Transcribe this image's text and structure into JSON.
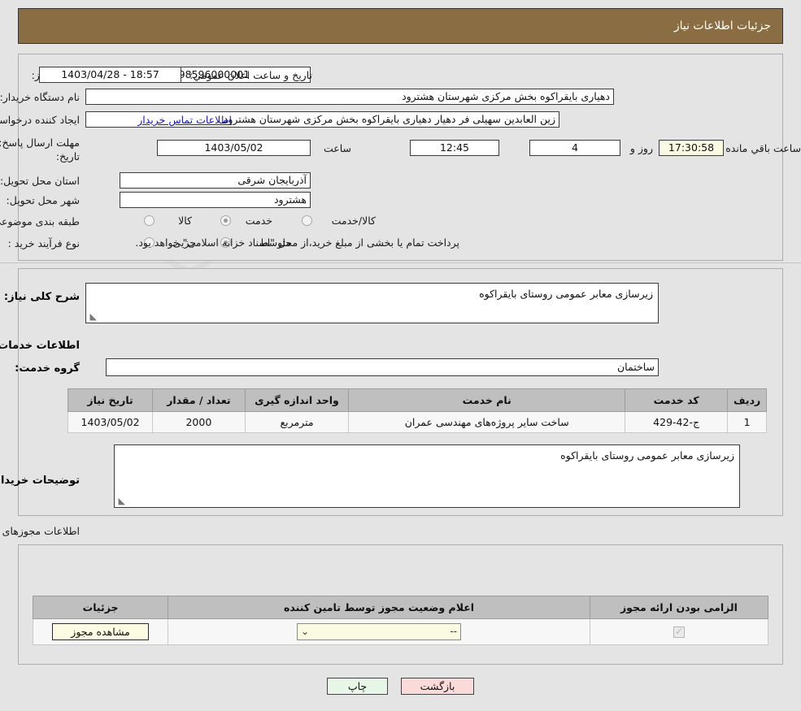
{
  "header": {
    "title": "جزئیات اطلاعات نیاز"
  },
  "watermark": {
    "text": "AnaTender.net"
  },
  "form": {
    "need_number_label": "شماره نیاز:",
    "need_number_value": "1103098596000001",
    "announce_datetime_label": "تاریخ و ساعت اعلان عمومي:",
    "announce_datetime_value": "1403/04/28 - 18:57",
    "buyer_org_label": "نام دستگاه خریدار:",
    "buyer_org_value": "دهیاری بایقراکوه بخش مرکزی شهرستان هشترود",
    "creator_label": "ایجاد کننده درخواست:",
    "creator_value": "زین العابدین سهیلی فر دهیار دهیاری بایقراکوه بخش مرکزی شهرستان هشترود",
    "buyer_contact_link": "اطلاعات تماس خریدار",
    "deadline_label": "مهلت ارسال پاسخ: تا تاریخ:",
    "deadline_date": "1403/05/02",
    "deadline_time_label": "ساعت",
    "deadline_time": "12:45",
    "remaining_days": "4",
    "remaining_days_label": "روز و",
    "remaining_time": "17:30:58",
    "remaining_time_label": "ساعت باقي مانده",
    "province_label": "استان محل تحویل:",
    "province_value": "آذربایجان شرقی",
    "city_label": "شهر محل تحویل:",
    "city_value": "هشترود",
    "category_label": "طبقه بندی موضوعی:",
    "category_options": [
      {
        "label": "کالا",
        "selected": false
      },
      {
        "label": "خدمت",
        "selected": true
      },
      {
        "label": "کالا/خدمت",
        "selected": false
      }
    ],
    "process_label": "نوع فرآیند خرید :",
    "process_options": [
      {
        "label": "جزیی",
        "selected": false
      },
      {
        "label": "متوسط",
        "selected": true
      }
    ],
    "treasury_note": "پرداخت تمام یا بخشی از مبلغ خرید،از محل \"اسناد خزانه اسلامی\" خواهد بود."
  },
  "middle": {
    "general_desc_label": "شرح کلی نیاز:",
    "general_desc_value": "زیرسازی معابر عمومی روستای بایقراکوه",
    "services_info_title": "اطلاعات خدمات مورد نیاز",
    "service_group_label": "گروه خدمت:",
    "service_group_value": "ساختمان",
    "buyer_notes_label": "توضیحات خریدار:",
    "buyer_notes_value": "زیرسازی معابر عمومی روستای بایقراکوه"
  },
  "services_table": {
    "columns": [
      "ردیف",
      "کد خدمت",
      "نام خدمت",
      "واحد اندازه گیری",
      "تعداد / مقدار",
      "تاریخ نیاز"
    ],
    "rows": [
      {
        "row_no": "1",
        "service_code": "ج-42-429",
        "service_name": "ساخت سایر پروژه‌های مهندسی عمران",
        "unit": "مترمربع",
        "quantity": "2000",
        "need_date": "1403/05/02"
      }
    ]
  },
  "permits": {
    "section_title": "اطلاعات مجوزهای ارائه خدمت / کالا",
    "columns": [
      "الزامی بودن ارائه مجوز",
      "اعلام وضعیت مجوز توسط تامین کننده",
      "جزئیات"
    ],
    "rows": [
      {
        "required_checked": true,
        "status_selected": "--",
        "details_button": "مشاهده مجوز"
      }
    ]
  },
  "footer": {
    "print_button": "چاپ",
    "back_button": "بازگشت"
  }
}
